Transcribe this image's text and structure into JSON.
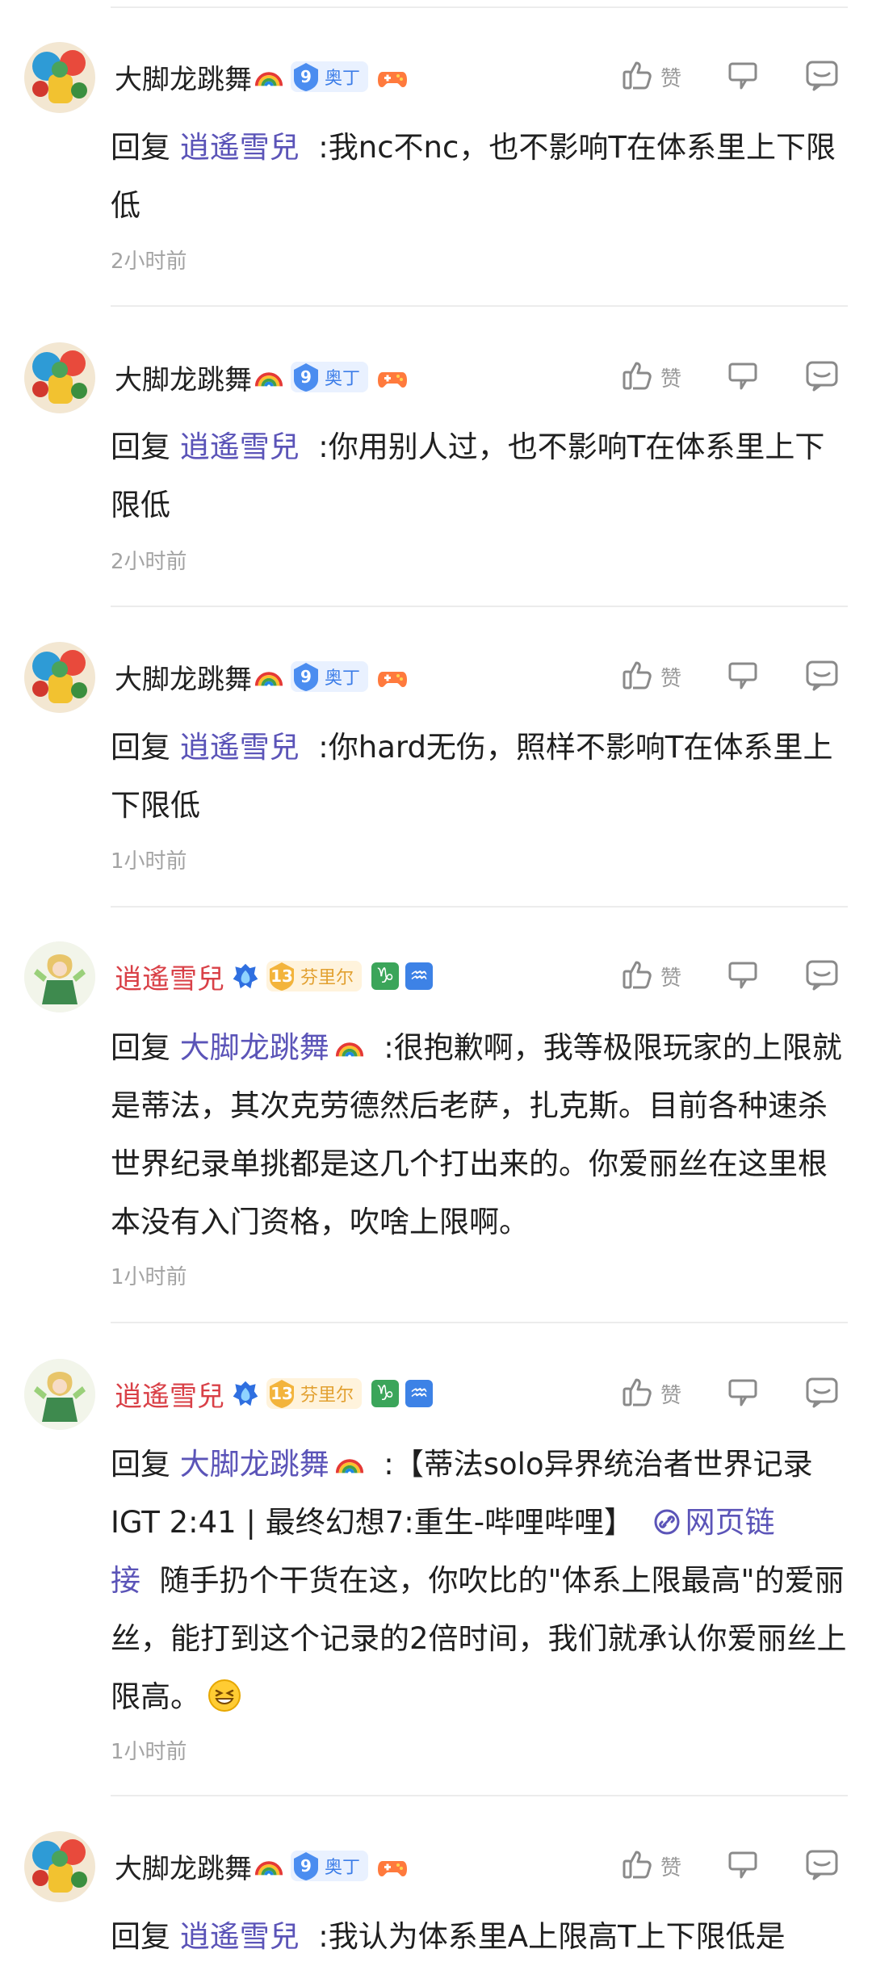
{
  "comments": [
    {
      "username": "大脚龙跳舞",
      "user_type": "a",
      "level": "9",
      "badge_title": "奥丁",
      "like_label": "赞",
      "reply_prefix": "回复",
      "mention": "逍遙雪兒",
      "text": ":我nc不nc，也不影响T在体系里上下限低",
      "time": "2小时前"
    },
    {
      "username": "大脚龙跳舞",
      "user_type": "a",
      "level": "9",
      "badge_title": "奥丁",
      "like_label": "赞",
      "reply_prefix": "回复",
      "mention": "逍遙雪兒",
      "text": ":你用别人过，也不影响T在体系里上下限低",
      "time": "2小时前"
    },
    {
      "username": "大脚龙跳舞",
      "user_type": "a",
      "level": "9",
      "badge_title": "奥丁",
      "like_label": "赞",
      "reply_prefix": "回复",
      "mention": "逍遙雪兒",
      "text": ":你hard无伤，照样不影响T在体系里上下限低",
      "time": "1小时前"
    },
    {
      "username": "逍遙雪兒",
      "user_type": "b",
      "level": "13",
      "badge_title": "芬里尔",
      "like_label": "赞",
      "reply_prefix": "回复",
      "mention": "大脚龙跳舞",
      "text": ":很抱歉啊，我等极限玩家的上限就是蒂法，其次克劳德然后老萨，扎克斯。目前各种速杀世界纪录单挑都是这几个打出来的。你爱丽丝在这里根本没有入门资格，吹啥上限啊。",
      "time": "1小时前"
    },
    {
      "username": "逍遙雪兒",
      "user_type": "b",
      "level": "13",
      "badge_title": "芬里尔",
      "like_label": "赞",
      "reply_prefix": "回复",
      "mention": "大脚龙跳舞",
      "text": ":【蒂法solo异界统治者世界记录IGT 2:41 | 最终幻想7:重生-哔哩哔哩】",
      "link_text": "网页链接",
      "text_after": "随手扔个干货在这，你吹比的\"体系上限最高\"的爱丽丝，能打到这个记录的2倍时间，我们就承认你爱丽丝上限高。",
      "time": "1小时前"
    },
    {
      "username": "大脚龙跳舞",
      "user_type": "a",
      "level": "9",
      "badge_title": "奥丁",
      "like_label": "赞",
      "reply_prefix": "回复",
      "mention": "逍遙雪兒",
      "text": ":我认为体系里A上限高T上下限低是",
      "time": ""
    }
  ],
  "colors": {
    "mention": "#5b54b8",
    "username_highlight": "#d94047",
    "level_blue": "#3c7de8",
    "level_gold": "#e2a030",
    "secondary_text": "#a3a3a3",
    "divider": "#ececec"
  },
  "icons": {
    "like": "thumb-up-icon",
    "dislike": "thumb-down-icon",
    "reply": "chat-bubble-icon",
    "link": "link-icon",
    "emoji": "grin-emoji-icon",
    "rainbow": "rainbow-icon",
    "gamepad": "gamepad-icon",
    "crest": "crest-badge-icon",
    "capricorn": "capricorn-icon",
    "aquarius": "aquarius-icon"
  }
}
